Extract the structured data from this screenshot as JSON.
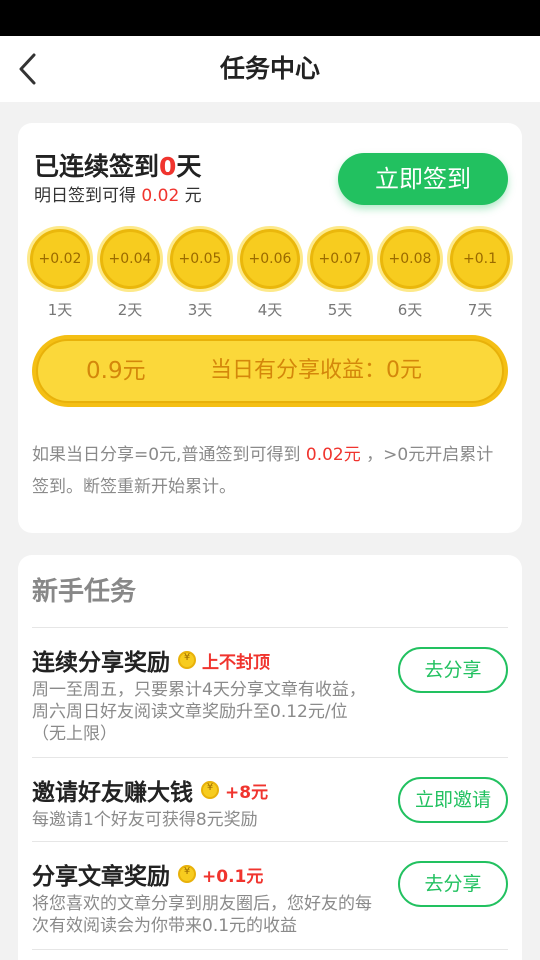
{
  "nav": {
    "title": "任务中心",
    "back_icon": "chevron-left-icon"
  },
  "signin": {
    "streak_prefix": "已连续签到",
    "streak_days": "0",
    "streak_suffix": "天",
    "tomorrow_prefix": "明日签到可得",
    "tomorrow_amount": "0.02",
    "tomorrow_suffix": "元",
    "button_label": "立即签到",
    "coins": [
      {
        "amount": "+0.02",
        "day": "1天"
      },
      {
        "amount": "+0.04",
        "day": "2天"
      },
      {
        "amount": "+0.05",
        "day": "3天"
      },
      {
        "amount": "+0.06",
        "day": "4天"
      },
      {
        "amount": "+0.07",
        "day": "5天"
      },
      {
        "amount": "+0.08",
        "day": "6天"
      },
      {
        "amount": "+0.1",
        "day": "7天"
      }
    ],
    "earn_total": "0.9元",
    "earn_share": "当日有分享收益：0元",
    "note_part1": "如果当日分享=0元,普通签到可得到 ",
    "note_amount": "0.02元",
    "note_part2": " ，>0元开启累计签到。断签重新开始累计。"
  },
  "tasks": {
    "section_title": "新手任务",
    "items": [
      {
        "name": "连续分享奖励",
        "reward": "上不封顶",
        "desc": "周一至周五，只要累计4天分享文章有收益，周六周日好友阅读文章奖励升至0.12元/位（无上限）",
        "action": "去分享"
      },
      {
        "name": "邀请好友赚大钱",
        "reward": "+8元",
        "desc": "每邀请1个好友可获得8元奖励",
        "action": "立即邀请"
      },
      {
        "name": "分享文章奖励",
        "reward": "+0.1元",
        "desc": "将您喜欢的文章分享到朋友圈后，您好友的每次有效阅读会为你带来0.1元的收益",
        "action": "去分享"
      }
    ]
  },
  "colors": {
    "accent": "#22c160",
    "highlight": "#f0342e",
    "gold": "#f7cc1f"
  }
}
